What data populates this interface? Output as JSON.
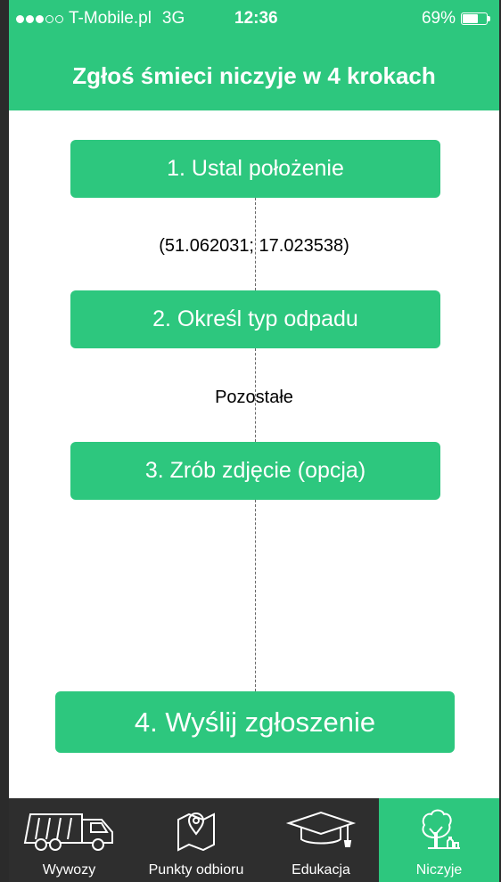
{
  "status_bar": {
    "carrier": "T-Mobile.pl",
    "network": "3G",
    "time": "12:36",
    "battery": "69%",
    "battery_level": 0.69
  },
  "header": {
    "title": "Zgłoś śmieci niczyje w 4 krokach"
  },
  "steps": [
    {
      "label": "1. Ustal położenie"
    },
    {
      "label": "2. Określ typ odpadu"
    },
    {
      "label": "3. Zrób zdjęcie (opcja)"
    },
    {
      "label": "4. Wyślij zgłoszenie"
    }
  ],
  "values": {
    "location": "(51.062031; 17.023538)",
    "waste_type": "Pozostałe"
  },
  "tabbar": {
    "items": [
      {
        "label": "Wywozy",
        "icon": "garbage-truck-icon"
      },
      {
        "label": "Punkty odbioru",
        "icon": "map-pin-icon"
      },
      {
        "label": "Edukacja",
        "icon": "graduation-cap-icon"
      },
      {
        "label": "Niczyje",
        "icon": "tree-bottle-icon",
        "active": true
      }
    ]
  },
  "colors": {
    "accent": "#2dc77e",
    "tabbar": "#2e2e2e"
  }
}
